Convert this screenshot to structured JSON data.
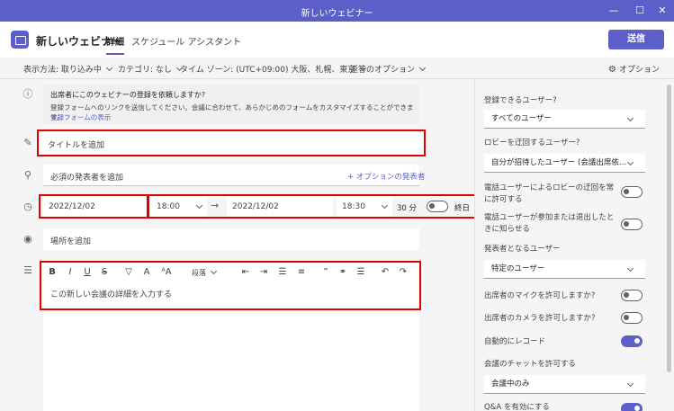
{
  "window": {
    "title": "新しいウェビナー",
    "min": "—",
    "max": "☐",
    "close": "✕"
  },
  "header": {
    "title": "新しいウェビナー",
    "tabs": [
      "詳細",
      "スケジュール アシスタント"
    ],
    "send_label": "送信"
  },
  "toolbar": {
    "view": "表示方法: 取り込み中",
    "category": "カテゴリ: なし",
    "timezone": "タイム ゾーン: (UTC+09:00) 大阪、札幌、東京",
    "reply": "返答のオプション",
    "options": "オプション"
  },
  "notice": {
    "line1": "出席者にこのウェビナーの登録を依頼しますか?",
    "line2": "登録フォームへのリンクを送信してください。会議に合わせて、あらかじめのフォームをカスタマイズすることができます。",
    "link": "登録フォームの表示"
  },
  "form": {
    "title_placeholder": "タイトルを追加",
    "presenter_placeholder": "必須の発表者を追加",
    "optional_presenter": "+ オプションの発表者",
    "start_date": "2022/12/02",
    "start_time": "18:00",
    "end_date": "2022/12/02",
    "end_time": "18:30",
    "duration": "30 分",
    "all_day": "終日",
    "location_placeholder": "場所を追加",
    "details_placeholder": "この新しい会議の詳細を入力する",
    "paragraph": "段落"
  },
  "side": {
    "who_can_register_label": "登録できるユーザー?",
    "who_can_register_value": "すべてのユーザー",
    "lobby_label": "ロビーを迂回するユーザー?",
    "lobby_value": "自分が招待したユーザー (会議出席依…",
    "phone_bypass": "電話ユーザーによるロビーの迂回を常に許可する",
    "phone_notify": "電話ユーザーが参加または退出したときに知らせる",
    "presenters_label": "発表者となるユーザー",
    "presenters_value": "特定のユーザー",
    "allow_mic": "出席者のマイクを許可しますか?",
    "allow_camera": "出席者のカメラを許可しますか?",
    "auto_record": "自動的にレコード",
    "chat_label": "会議のチャットを許可する",
    "chat_value": "会議中のみ",
    "qa_label": "Q&A を有効にする"
  }
}
